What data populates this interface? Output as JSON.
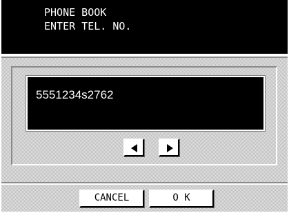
{
  "header": {
    "line1": "PHONE BOOK",
    "line2": "ENTER TEL. NO."
  },
  "display": {
    "number": "5551234s2762"
  },
  "navigation": {
    "left_icon": "left-triangle",
    "right_icon": "right-triangle"
  },
  "footer": {
    "cancel_label": "CANCEL",
    "ok_label": "O K"
  },
  "colors": {
    "background": "#ffffff",
    "display_background": "#000000",
    "display_text": "#ffffff",
    "panel_pattern": "#c8c8c8"
  }
}
